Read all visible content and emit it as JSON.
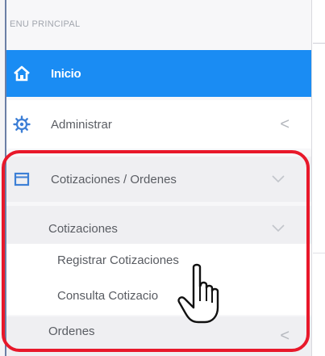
{
  "menu": {
    "header": "ENU PRINCIPAL",
    "items": [
      {
        "label": "Inicio",
        "icon": "home-icon",
        "active": true
      },
      {
        "label": "Administrar",
        "icon": "gear-icon",
        "chevron": "<"
      },
      {
        "label": "Cotizaciones / Ordenes",
        "icon": "window-icon",
        "chevron": "v",
        "expanded": true
      }
    ],
    "cotizaciones": {
      "label": "Cotizaciones",
      "chevron": "v",
      "expanded": true
    },
    "submenu": [
      {
        "label": "Registrar Cotizaciones"
      },
      {
        "label": "Consulta Cotizacio"
      }
    ],
    "ordenes": {
      "label": "Ordenes",
      "chevron": "<"
    }
  },
  "colors": {
    "active_bg": "#1a8cf3",
    "highlight_border": "#e8182a"
  },
  "icons": {
    "cursor": "hand-pointer-icon"
  }
}
